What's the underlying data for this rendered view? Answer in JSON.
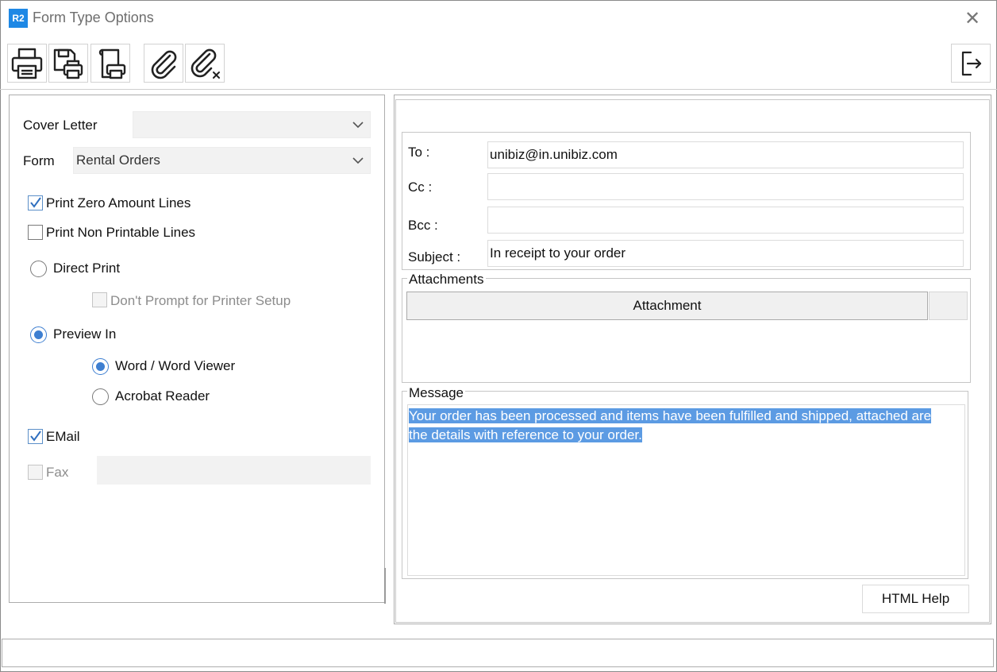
{
  "window": {
    "logo": "R2",
    "title": "Form Type Options",
    "close_icon": "close-icon"
  },
  "toolbar": {
    "buttons": [
      {
        "name": "print",
        "icon": "printer-icon"
      },
      {
        "name": "save-print",
        "icon": "save-printer-icon"
      },
      {
        "name": "printer-setup",
        "icon": "printer-setup-icon"
      },
      {
        "name": "attach",
        "icon": "paperclip-icon"
      },
      {
        "name": "remove-attach",
        "icon": "paperclip-remove-icon"
      },
      {
        "name": "exit",
        "icon": "exit-icon"
      }
    ]
  },
  "left": {
    "cover_letter_label": "Cover Letter",
    "cover_letter_value": "",
    "form_label": "Form",
    "form_value": "Rental Orders",
    "print_zero_amount": {
      "label": "Print Zero Amount Lines",
      "checked": true
    },
    "print_non_printable": {
      "label": "Print Non Printable Lines",
      "checked": false
    },
    "direct_print": {
      "label": "Direct Print",
      "selected": false
    },
    "dont_prompt": {
      "label": "Don't Prompt for Printer Setup",
      "checked": false,
      "disabled": true
    },
    "preview_in": {
      "label": "Preview In",
      "selected": true
    },
    "word_viewer": {
      "label": "Word / Word Viewer",
      "selected": true
    },
    "acrobat": {
      "label": "Acrobat Reader",
      "selected": false
    },
    "email": {
      "label": "EMail",
      "checked": true
    },
    "fax": {
      "label": "Fax",
      "checked": false,
      "disabled": true,
      "value": ""
    }
  },
  "email": {
    "to_label": "To :",
    "to_value": "unibiz@in.unibiz.com",
    "cc_label": "Cc :",
    "cc_value": "",
    "bcc_label": "Bcc :",
    "bcc_value": "",
    "subject_label": "Subject :",
    "subject_value": "In receipt to your order",
    "attachments_title": "Attachments",
    "attachment_column": "Attachment",
    "message_title": "Message",
    "message_line1": "Your order has been processed and items have been fulfilled and shipped, attached are",
    "message_line2": "the details with reference to your order.",
    "help_label": "HTML Help"
  },
  "colors": {
    "accent": "#3e7fd1",
    "selection": "#5c9be3",
    "logo": "#1e88e5"
  }
}
